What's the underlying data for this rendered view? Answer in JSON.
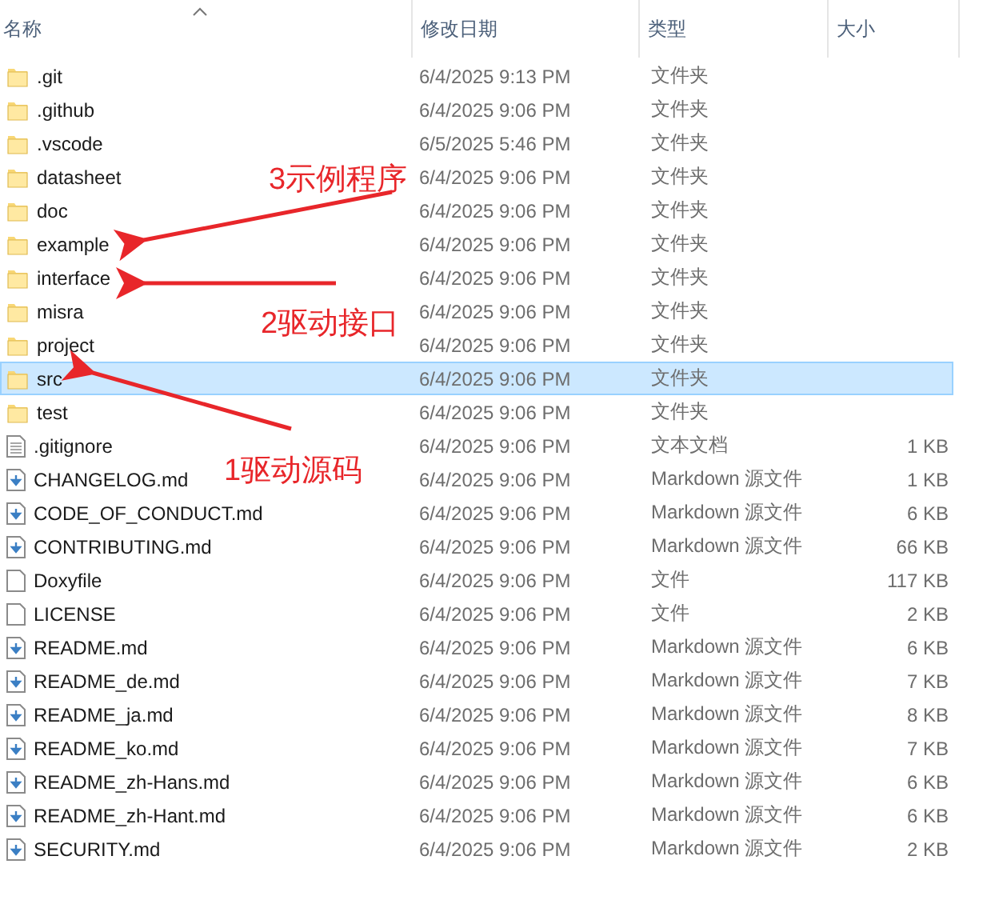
{
  "columns": [
    "名称",
    "修改日期",
    "类型",
    "大小"
  ],
  "rows": [
    {
      "name": ".git",
      "date": "6/4/2025 9:13 PM",
      "type": "文件夹",
      "kind": "folder",
      "selected": false
    },
    {
      "name": ".github",
      "date": "6/4/2025 9:06 PM",
      "type": "文件夹",
      "kind": "folder",
      "selected": false
    },
    {
      "name": ".vscode",
      "date": "6/5/2025 5:46 PM",
      "type": "文件夹",
      "kind": "folder",
      "selected": false
    },
    {
      "name": "datasheet",
      "date": "6/4/2025 9:06 PM",
      "type": "文件夹",
      "kind": "folder",
      "selected": false
    },
    {
      "name": "doc",
      "date": "6/4/2025 9:06 PM",
      "type": "文件夹",
      "kind": "folder",
      "selected": false
    },
    {
      "name": "example",
      "date": "6/4/2025 9:06 PM",
      "type": "文件夹",
      "kind": "folder",
      "selected": false
    },
    {
      "name": "interface",
      "date": "6/4/2025 9:06 PM",
      "type": "文件夹",
      "kind": "folder",
      "selected": false
    },
    {
      "name": "misra",
      "date": "6/4/2025 9:06 PM",
      "type": "文件夹",
      "kind": "folder",
      "selected": false
    },
    {
      "name": "project",
      "date": "6/4/2025 9:06 PM",
      "type": "文件夹",
      "kind": "folder",
      "selected": false
    },
    {
      "name": "src",
      "date": "6/4/2025 9:06 PM",
      "type": "文件夹",
      "kind": "folder",
      "selected": true
    },
    {
      "name": "test",
      "date": "6/4/2025 9:06 PM",
      "type": "文件夹",
      "kind": "folder",
      "selected": false
    },
    {
      "name": ".gitignore",
      "date": "6/4/2025 9:06 PM",
      "type": "文本文档",
      "size": "1 KB",
      "kind": "text",
      "selected": false
    },
    {
      "name": "CHANGELOG.md",
      "date": "6/4/2025 9:06 PM",
      "type": "Markdown 源文件",
      "size": "1 KB",
      "kind": "markdown",
      "selected": false
    },
    {
      "name": "CODE_OF_CONDUCT.md",
      "date": "6/4/2025 9:06 PM",
      "type": "Markdown 源文件",
      "size": "6 KB",
      "kind": "markdown",
      "selected": false
    },
    {
      "name": "CONTRIBUTING.md",
      "date": "6/4/2025 9:06 PM",
      "type": "Markdown 源文件",
      "size": "66 KB",
      "kind": "markdown",
      "selected": false
    },
    {
      "name": "Doxyfile",
      "date": "6/4/2025 9:06 PM",
      "type": "文件",
      "size": "117 KB",
      "kind": "file",
      "selected": false
    },
    {
      "name": "LICENSE",
      "date": "6/4/2025 9:06 PM",
      "type": "文件",
      "size": "2 KB",
      "kind": "file",
      "selected": false
    },
    {
      "name": "README.md",
      "date": "6/4/2025 9:06 PM",
      "type": "Markdown 源文件",
      "size": "6 KB",
      "kind": "markdown",
      "selected": false
    },
    {
      "name": "README_de.md",
      "date": "6/4/2025 9:06 PM",
      "type": "Markdown 源文件",
      "size": "7 KB",
      "kind": "markdown",
      "selected": false
    },
    {
      "name": "README_ja.md",
      "date": "6/4/2025 9:06 PM",
      "type": "Markdown 源文件",
      "size": "8 KB",
      "kind": "markdown",
      "selected": false
    },
    {
      "name": "README_ko.md",
      "date": "6/4/2025 9:06 PM",
      "type": "Markdown 源文件",
      "size": "7 KB",
      "kind": "markdown",
      "selected": false
    },
    {
      "name": "README_zh-Hans.md",
      "date": "6/4/2025 9:06 PM",
      "type": "Markdown 源文件",
      "size": "6 KB",
      "kind": "markdown",
      "selected": false
    },
    {
      "name": "README_zh-Hant.md",
      "date": "6/4/2025 9:06 PM",
      "type": "Markdown 源文件",
      "size": "6 KB",
      "kind": "markdown",
      "selected": false
    },
    {
      "name": "SECURITY.md",
      "date": "6/4/2025 9:06 PM",
      "type": "Markdown 源文件",
      "size": "2 KB",
      "kind": "markdown",
      "selected": false
    }
  ],
  "annotations": [
    {
      "text": "3示例程序"
    },
    {
      "text": "2驱动接口"
    },
    {
      "text": "1驱动源码"
    }
  ]
}
